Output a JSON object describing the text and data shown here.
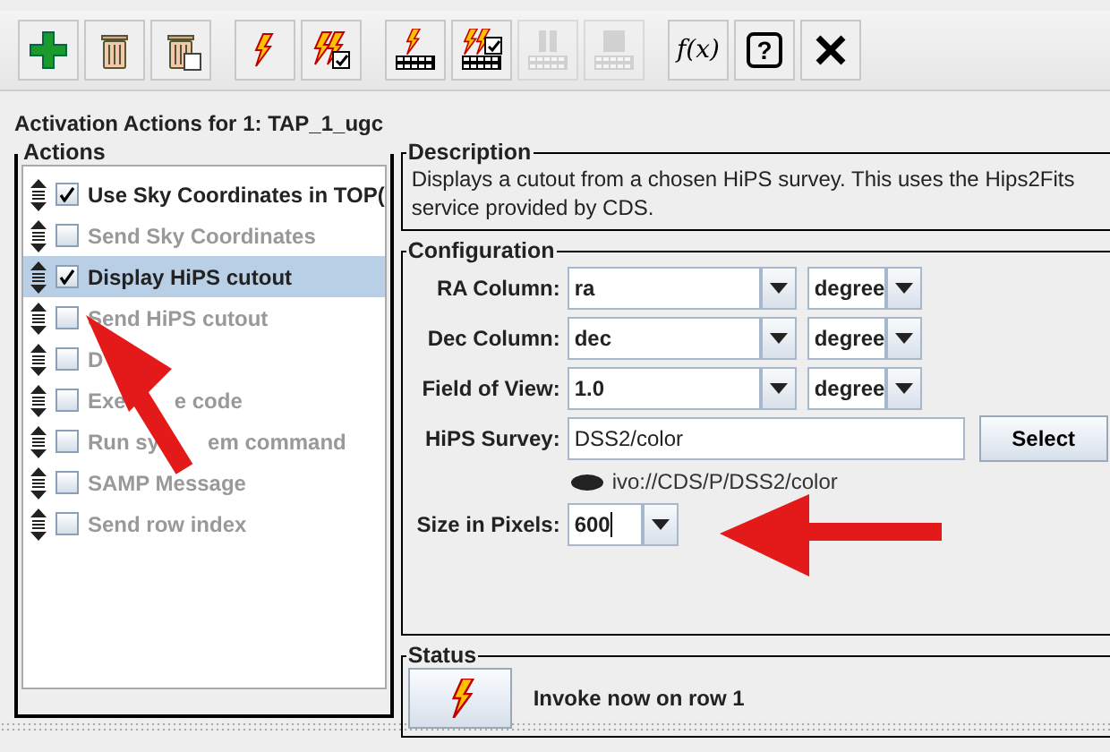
{
  "toolbar": {
    "groups": [
      {
        "buttons": [
          {
            "kind": "add",
            "disabled": false
          },
          {
            "kind": "trash",
            "disabled": false
          },
          {
            "kind": "trash-all",
            "disabled": false
          }
        ]
      },
      {
        "buttons": [
          {
            "kind": "bolt",
            "disabled": false
          },
          {
            "kind": "bolt-check",
            "disabled": false
          }
        ]
      },
      {
        "buttons": [
          {
            "kind": "film-bolt",
            "disabled": false
          },
          {
            "kind": "film-bolt-check",
            "disabled": false
          },
          {
            "kind": "film-pause",
            "disabled": true
          },
          {
            "kind": "film-stop",
            "disabled": true
          }
        ]
      },
      {
        "buttons": [
          {
            "kind": "function",
            "label": "f(x)",
            "disabled": false
          },
          {
            "kind": "help",
            "label": "?",
            "disabled": false
          },
          {
            "kind": "close",
            "disabled": false
          }
        ]
      }
    ]
  },
  "panel_title": "Activation Actions for 1: TAP_1_ugc",
  "actions": {
    "title": "Actions",
    "items": [
      {
        "label": "Use Sky Coordinates in TOP(",
        "checked": true,
        "selected": false
      },
      {
        "label": "Send Sky Coordinates",
        "checked": false,
        "selected": false
      },
      {
        "label": "Display HiPS cutout",
        "checked": true,
        "selected": true
      },
      {
        "label": "Send HiPS cutout",
        "checked": false,
        "selected": false
      },
      {
        "label": "D",
        "checked": false,
        "selected": false
      },
      {
        "label": "Exe",
        "label_after": "e code",
        "checked": false,
        "selected": false
      },
      {
        "label": "Run sy",
        "label_after": "em command",
        "checked": false,
        "selected": false
      },
      {
        "label": "SAMP Message",
        "checked": false,
        "selected": false
      },
      {
        "label": "Send row index",
        "checked": false,
        "selected": false
      }
    ]
  },
  "description": {
    "title": "Description",
    "text": "Displays a cutout from a chosen HiPS survey. This uses the Hips2Fits service provided by CDS."
  },
  "configuration": {
    "title": "Configuration",
    "rows": [
      {
        "kind": "column",
        "label": "RA Column:",
        "value": "ra",
        "unit": "degree"
      },
      {
        "kind": "column",
        "label": "Dec Column:",
        "value": "dec",
        "unit": "degree"
      },
      {
        "kind": "column",
        "label": "Field of View:",
        "value": "1.0",
        "unit": "degree"
      },
      {
        "kind": "survey",
        "label": "HiPS Survey:",
        "value": "DSS2/color",
        "button": "Select",
        "ivo": "ivo://CDS/P/DSS2/color"
      },
      {
        "kind": "size",
        "label": "Size in Pixels:",
        "value": "600"
      }
    ]
  },
  "status": {
    "title": "Status",
    "text": "Invoke now on row 1"
  }
}
